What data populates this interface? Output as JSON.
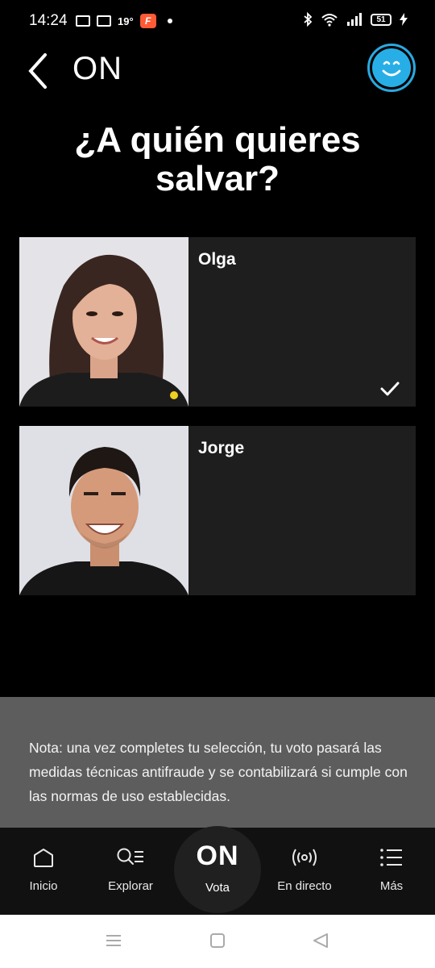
{
  "status_bar": {
    "time": "14:24",
    "temperature": "19°",
    "flash_app_letter": "F",
    "battery": "51"
  },
  "header": {
    "title": "ON"
  },
  "question": {
    "line1": "¿A quién quieres",
    "line2": "salvar?"
  },
  "candidates": [
    {
      "name": "Olga",
      "selected": true
    },
    {
      "name": "Jorge",
      "selected": false
    }
  ],
  "note": {
    "text": "Nota: una vez completes tu selección, tu voto pasará las medidas técnicas antifraude y se contabilizará si cumple con las normas de uso establecidas."
  },
  "bottom_nav": {
    "items": [
      {
        "label": "Inicio",
        "icon": "home-icon"
      },
      {
        "label": "Explorar",
        "icon": "search-list-icon"
      },
      {
        "label": "Vota",
        "icon": "on-logo"
      },
      {
        "label": "En directo",
        "icon": "broadcast-icon"
      },
      {
        "label": "Más",
        "icon": "menu-list-icon"
      }
    ],
    "vota_logo_text": "ON"
  },
  "colors": {
    "accent": "#28aee6",
    "background": "#000000",
    "card": "#1e1e1e",
    "note_bg": "#5d5d5d"
  }
}
